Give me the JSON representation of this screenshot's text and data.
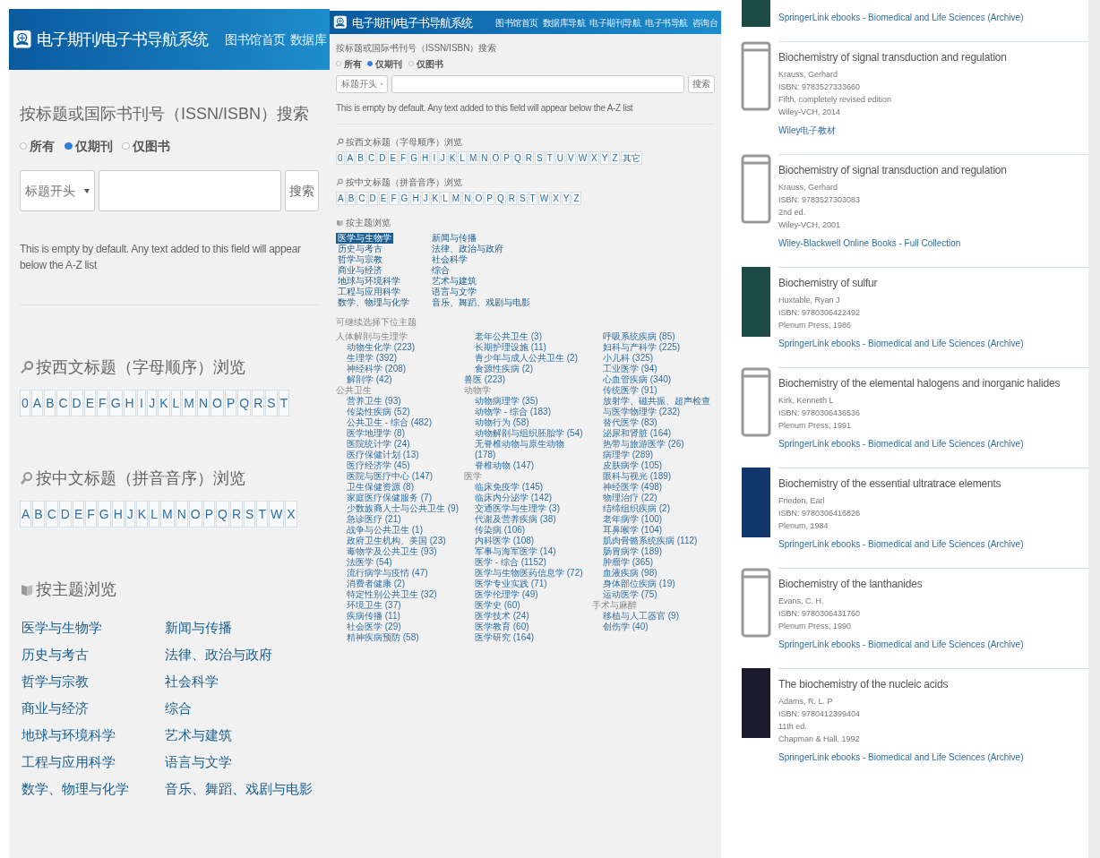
{
  "zoomed_view": {
    "header": {
      "title": "电子期刊/电子书导航系统",
      "nav": [
        "图书馆首页",
        "数据库"
      ]
    },
    "search": {
      "heading": "按标题或国际书刊号（ISSN/ISBN）搜索",
      "scopes": [
        {
          "label": "所有",
          "selected": false
        },
        {
          "label": "仅期刊",
          "selected": true
        },
        {
          "label": "仅图书",
          "selected": false
        }
      ],
      "mode": "标题开头",
      "button": "搜索",
      "note": "This is empty by default. Any text added to this field will appear below the A-Z list"
    },
    "western_browse": {
      "heading": "按西文标题（字母顺序）浏览",
      "letters": [
        "0",
        "A",
        "B",
        "C",
        "D",
        "E",
        "F",
        "G",
        "H",
        "I",
        "J",
        "K",
        "L",
        "M",
        "N",
        "O",
        "P",
        "Q",
        "R",
        "S",
        "T"
      ]
    },
    "chinese_browse": {
      "heading": "按中文标题（拼音音序）浏览",
      "letters": [
        "A",
        "B",
        "C",
        "D",
        "E",
        "F",
        "G",
        "H",
        "J",
        "K",
        "L",
        "M",
        "N",
        "O",
        "P",
        "Q",
        "R",
        "S",
        "T",
        "W",
        "X"
      ]
    },
    "subject_browse": {
      "heading": "按主题浏览",
      "subjects": [
        {
          "label": "医学与生物学",
          "selected": false
        },
        {
          "label": "历史与考古",
          "selected": false
        },
        {
          "label": "哲学与宗教",
          "selected": false
        },
        {
          "label": "商业与经济",
          "selected": false
        },
        {
          "label": "地球与环境科学",
          "selected": false
        },
        {
          "label": "工程与应用科学",
          "selected": false
        },
        {
          "label": "数学、物理与化学",
          "selected": false
        },
        {
          "label": "新闻与传播",
          "selected": false
        },
        {
          "label": "法律、政治与政府",
          "selected": false
        },
        {
          "label": "社会科学",
          "selected": false
        },
        {
          "label": "综合",
          "selected": false
        },
        {
          "label": "艺术与建筑",
          "selected": false
        },
        {
          "label": "语言与文学",
          "selected": false
        },
        {
          "label": "音乐、舞蹈、戏剧与电影",
          "selected": false
        }
      ]
    }
  },
  "full_page": {
    "header": {
      "title": "电子期刊/电子书导航系统",
      "nav": [
        "图书馆首页",
        "数据库导航",
        "电子期刊导航",
        "电子书导航",
        "咨询台"
      ]
    },
    "search": {
      "heading": "按标题或国际书刊号（ISSN/ISBN）搜索",
      "scopes": [
        {
          "label": "所有",
          "selected": false
        },
        {
          "label": "仅期刊",
          "selected": true
        },
        {
          "label": "仅图书",
          "selected": false
        }
      ],
      "mode": "标题开头",
      "button": "搜索",
      "note": "This is empty by default. Any text added to this field will appear below the A-Z list"
    },
    "western_browse": {
      "heading": "按西文标题（字母顺序）浏览",
      "letters": [
        "0",
        "A",
        "B",
        "C",
        "D",
        "E",
        "F",
        "G",
        "H",
        "I",
        "J",
        "K",
        "L",
        "M",
        "N",
        "O",
        "P",
        "Q",
        "R",
        "S",
        "T",
        "U",
        "V",
        "W",
        "X",
        "Y",
        "Z",
        "其它"
      ]
    },
    "chinese_browse": {
      "heading": "按中文标题（拼音音序）浏览",
      "letters": [
        "A",
        "B",
        "C",
        "D",
        "E",
        "F",
        "G",
        "H",
        "J",
        "K",
        "L",
        "M",
        "N",
        "O",
        "P",
        "Q",
        "R",
        "S",
        "T",
        "W",
        "X",
        "Y",
        "Z"
      ]
    },
    "subject_browse": {
      "heading": "按主题浏览",
      "subjects": [
        {
          "label": "医学与生物学",
          "selected": true
        },
        {
          "label": "历史与考古",
          "selected": false
        },
        {
          "label": "哲学与宗教",
          "selected": false
        },
        {
          "label": "商业与经济",
          "selected": false
        },
        {
          "label": "地球与环境科学",
          "selected": false
        },
        {
          "label": "工程与应用科学",
          "selected": false
        },
        {
          "label": "数学、物理与化学",
          "selected": false
        },
        {
          "label": "新闻与传播",
          "selected": false
        },
        {
          "label": "法律、政治与政府",
          "selected": false
        },
        {
          "label": "社会科学",
          "selected": false
        },
        {
          "label": "综合",
          "selected": false
        },
        {
          "label": "艺术与建筑",
          "selected": false
        },
        {
          "label": "语言与文学",
          "selected": false
        },
        {
          "label": "音乐、舞蹈、戏剧与电影",
          "selected": false
        }
      ]
    },
    "subtopics": {
      "heading": "可继续选择下位主题",
      "tree": [
        {
          "label": "人体解剖与生理学",
          "kind": "category",
          "children": [
            {
              "label": "动物生化学 (223)"
            },
            {
              "label": "生理学 (392)"
            },
            {
              "label": "神经科学 (208)"
            },
            {
              "label": "解剖学 (42)"
            }
          ]
        },
        {
          "label": "公共卫生",
          "kind": "category",
          "children": [
            {
              "label": "营养卫生 (93)"
            },
            {
              "label": "传染性疾病 (52)"
            },
            {
              "label": "公共卫生 - 综合 (482)"
            },
            {
              "label": "医学地理学 (8)"
            },
            {
              "label": "医院统计学 (24)"
            },
            {
              "label": "医疗保健计划 (13)"
            },
            {
              "label": "医疗经济学 (45)"
            },
            {
              "label": "医院与医疗中心 (147)"
            },
            {
              "label": "卫生保健资源 (8)"
            },
            {
              "label": "家庭医疗保健服务 (7)"
            },
            {
              "label": "少数族裔人士与公共卫生 (9)"
            },
            {
              "label": "急诊医疗 (21)"
            },
            {
              "label": "战争与公共卫生 (1)"
            },
            {
              "label": "政府卫生机构、美国 (23)"
            },
            {
              "label": "毒物学及公共卫生 (93)"
            },
            {
              "label": "法医学 (54)"
            },
            {
              "label": "流行病学与疫情 (47)"
            },
            {
              "label": "消费者健康 (2)"
            },
            {
              "label": "特定性别公共卫生 (32)"
            },
            {
              "label": "环境卫生 (37)"
            },
            {
              "label": "疾病传播 (11)"
            },
            {
              "label": "社会医学 (29)"
            },
            {
              "label": "精神疾病预防 (58)"
            },
            {
              "label": "老年公共卫生 (3)"
            },
            {
              "label": "长期护理设施 (11)"
            },
            {
              "label": "青少年与成人公共卫生 (2)"
            },
            {
              "label": "食源性疾病 (2)"
            }
          ]
        },
        {
          "label": "兽医 (223)",
          "kind": "link"
        },
        {
          "label": "动物学",
          "kind": "category",
          "children": [
            {
              "label": "动物病理学 (35)"
            },
            {
              "label": "动物学 - 综合 (183)"
            },
            {
              "label": "动物行为 (58)"
            },
            {
              "label": "动物解剖与组织胚胎学 (54)"
            },
            {
              "label": "无脊椎动物与原生动物 (178)"
            },
            {
              "label": "脊椎动物 (147)"
            }
          ]
        },
        {
          "label": "医学",
          "kind": "category",
          "children": [
            {
              "label": "临床免疫学 (145)"
            },
            {
              "label": "临床内分泌学 (142)"
            },
            {
              "label": "交通医学与生理学 (3)"
            },
            {
              "label": "代谢及营养疾病 (38)"
            },
            {
              "label": "传染病 (106)"
            },
            {
              "label": "内科医学 (108)"
            },
            {
              "label": "军事与海军医学 (14)"
            },
            {
              "label": "医学 - 综合 (1152)"
            },
            {
              "label": "医学与生物医药信息学 (72)"
            },
            {
              "label": "医学专业实践 (71)"
            },
            {
              "label": "医学伦理学 (49)"
            },
            {
              "label": "医学史 (60)"
            },
            {
              "label": "医学技术 (24)"
            },
            {
              "label": "医学教育 (60)"
            },
            {
              "label": "医学研究 (164)"
            },
            {
              "label": "呼吸系统疾病 (85)"
            },
            {
              "label": "妇科与产科学 (225)"
            },
            {
              "label": "小儿科 (325)"
            },
            {
              "label": "工业医学 (94)"
            },
            {
              "label": "心血管疾病 (340)"
            },
            {
              "label": "传统医学 (91)"
            },
            {
              "label": "放射学、磁共振、超声检查与医学物理学 (232)"
            },
            {
              "label": "替代医学 (83)"
            },
            {
              "label": "泌尿和肾脏 (164)"
            },
            {
              "label": "热带与旅游医学 (26)"
            },
            {
              "label": "病理学 (289)"
            },
            {
              "label": "皮肤病学 (105)"
            },
            {
              "label": "眼科与视光 (189)"
            },
            {
              "label": "神经医学 (498)"
            },
            {
              "label": "物理治疗 (22)"
            },
            {
              "label": "结缔组织疾病 (2)"
            },
            {
              "label": "老年病学 (100)"
            },
            {
              "label": "耳鼻喉学 (104)"
            },
            {
              "label": "肌肉骨骼系统疾病 (112)"
            },
            {
              "label": "肠胃病学 (189)"
            },
            {
              "label": "肿瘤学 (365)"
            },
            {
              "label": "血液疾病 (98)"
            },
            {
              "label": "身体部位疾病 (19)"
            },
            {
              "label": "运动医学 (75)"
            }
          ]
        },
        {
          "label": "手术与麻醉",
          "kind": "category",
          "children": [
            {
              "label": "移植与人工器官 (9)"
            },
            {
              "label": "创伤学 (40)"
            }
          ]
        }
      ]
    }
  },
  "results": {
    "partial_entry": {
      "cover": {
        "kind": "image",
        "color": "#1d4a44"
      },
      "link": "SpringerLink ebooks - Biomedical and Life Sciences (Archive)"
    },
    "books": [
      {
        "title": "Biochemistry of signal transduction and regulation",
        "author": "Krauss, Gerhard",
        "isbn": "ISBN: 9783527333660",
        "edition": "Fifth, completely revised edition",
        "publisher": "Wiley-VCH, 2014",
        "link": "Wiley电子教材",
        "cover": {
          "kind": "blank"
        }
      },
      {
        "title": "Biochemistry of signal transduction and regulation",
        "author": "Krauss, Gerhard",
        "isbn": "ISBN: 9783527303083",
        "edition": "2nd ed.",
        "publisher": "Wiley-VCH, 2001",
        "link": "Wiley-Blackwell Online Books - Full Collection",
        "cover": {
          "kind": "blank"
        }
      },
      {
        "title": "Biochemistry of sulfur",
        "author": "Huxtable, Ryan J",
        "isbn": "ISBN: 9780306422492",
        "publisher": "Plenum Press, 1986",
        "link": "SpringerLink ebooks - Biomedical and Life Sciences (Archive)",
        "cover": {
          "kind": "image",
          "color": "#1d4a44"
        }
      },
      {
        "title": "Biochemistry of the elemental halogens and inorganic halides",
        "author": "Kirk, Kenneth L",
        "isbn": "ISBN: 9780306436536",
        "publisher": "Plenum Press, 1991",
        "link": "SpringerLink ebooks - Biomedical and Life Sciences (Archive)",
        "cover": {
          "kind": "blank"
        }
      },
      {
        "title": "Biochemistry of the essential ultratrace elements",
        "author": "Frieden, Earl",
        "isbn": "ISBN: 9780306416826",
        "publisher": "Plenum, 1984",
        "link": "SpringerLink ebooks - Biomedical and Life Sciences (Archive)",
        "cover": {
          "kind": "image",
          "color": "#12366b"
        }
      },
      {
        "title": "Biochemistry of the lanthanides",
        "author": "Evans, C. H.",
        "isbn": "ISBN: 9780306431760",
        "publisher": "Plenum Press, 1990",
        "link": "SpringerLink ebooks - Biomedical and Life Sciences (Archive)",
        "cover": {
          "kind": "blank"
        }
      },
      {
        "title": "The biochemistry of the nucleic acids",
        "author": "Adams, R. L. P",
        "isbn": "ISBN: 9780412399404",
        "edition": "11th ed.",
        "publisher": "Chapman & Hall, 1992",
        "link": "SpringerLink ebooks - Biomedical and Life Sciences (Archive)",
        "cover": {
          "kind": "image",
          "color": "#1c1b2e"
        }
      }
    ]
  }
}
